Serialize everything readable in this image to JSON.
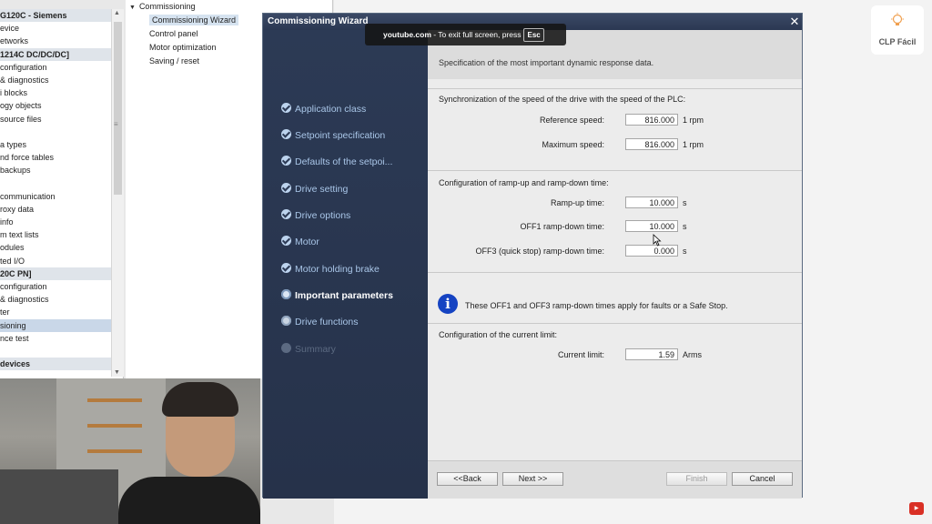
{
  "project_tree": {
    "items": [
      {
        "label": "G120C - Siemens",
        "style": "header"
      },
      {
        "label": "evice",
        "style": ""
      },
      {
        "label": "etworks",
        "style": ""
      },
      {
        "label": "1214C DC/DC/DC]",
        "style": "header"
      },
      {
        "label": "configuration",
        "style": ""
      },
      {
        "label": "& diagnostics",
        "style": ""
      },
      {
        "label": "i blocks",
        "style": ""
      },
      {
        "label": "ogy objects",
        "style": ""
      },
      {
        "label": "source files",
        "style": ""
      },
      {
        "label": "",
        "style": ""
      },
      {
        "label": "a types",
        "style": ""
      },
      {
        "label": "nd force tables",
        "style": ""
      },
      {
        "label": "backups",
        "style": ""
      },
      {
        "label": "",
        "style": ""
      },
      {
        "label": "communication",
        "style": ""
      },
      {
        "label": "roxy data",
        "style": ""
      },
      {
        "label": "info",
        "style": ""
      },
      {
        "label": "m text lists",
        "style": ""
      },
      {
        "label": "odules",
        "style": ""
      },
      {
        "label": "ted I/O",
        "style": ""
      },
      {
        "label": "20C PN]",
        "style": "header"
      },
      {
        "label": "configuration",
        "style": ""
      },
      {
        "label": "& diagnostics",
        "style": ""
      },
      {
        "label": "ter",
        "style": ""
      },
      {
        "label": "sioning",
        "style": "selected"
      },
      {
        "label": "nce test",
        "style": ""
      },
      {
        "label": "",
        "style": ""
      },
      {
        "label": "devices",
        "style": "header"
      }
    ]
  },
  "device_tree": {
    "root": "Commissioning",
    "children": [
      "Commissioning Wizard",
      "Control panel",
      "Motor optimization",
      "Saving / reset"
    ]
  },
  "wizard": {
    "title": "Commissioning Wizard",
    "close_glyph": "✕",
    "subtitle": "Specification of the most important dynamic response data.",
    "steps": [
      {
        "label": "Application class",
        "state": "done"
      },
      {
        "label": "Setpoint specification",
        "state": "done"
      },
      {
        "label": "Defaults of the setpoi...",
        "state": "done"
      },
      {
        "label": "Drive setting",
        "state": "done"
      },
      {
        "label": "Drive options",
        "state": "done"
      },
      {
        "label": "Motor",
        "state": "done"
      },
      {
        "label": "Motor holding brake",
        "state": "done"
      },
      {
        "label": "Important parameters",
        "state": "current"
      },
      {
        "label": "Drive functions",
        "state": "pending"
      },
      {
        "label": "Summary",
        "state": "disabled"
      }
    ],
    "sync_section": {
      "title": "Synchronization of the speed of the drive with the speed of the PLC:",
      "reference_speed": {
        "label": "Reference speed:",
        "value": "816.000",
        "unit": "1 rpm"
      },
      "maximum_speed": {
        "label": "Maximum speed:",
        "value": "816.000",
        "unit": "1 rpm"
      }
    },
    "ramp_section": {
      "title": "Configuration of ramp-up and ramp-down time:",
      "ramp_up": {
        "label": "Ramp-up time:",
        "value": "10.000",
        "unit": "s"
      },
      "off1": {
        "label": "OFF1 ramp-down time:",
        "value": "10.000",
        "unit": "s"
      },
      "off3": {
        "label": "OFF3 (quick stop) ramp-down time:",
        "value": "0.000",
        "unit": "s"
      }
    },
    "info_icon_glyph": "i",
    "info_text": "These OFF1 and OFF3 ramp-down times apply for faults or a Safe Stop.",
    "current_section": {
      "title": "Configuration of the current limit:",
      "current_limit": {
        "label": "Current limit:",
        "value": "1.59",
        "unit": "Arms"
      }
    },
    "buttons": {
      "back": "<<Back",
      "next": "Next >>",
      "finish": "Finish",
      "cancel": "Cancel"
    }
  },
  "yt_overlay": {
    "site": "youtube.com",
    "message": " - To exit full screen, press",
    "key": "Esc"
  },
  "logo": {
    "text": "CLP Fácil"
  },
  "colors": {
    "nav_bg": "#2c3a55",
    "nav_step": "#a9c6e8",
    "info_blue": "#1543c2",
    "titlebar": "#2b3852"
  }
}
